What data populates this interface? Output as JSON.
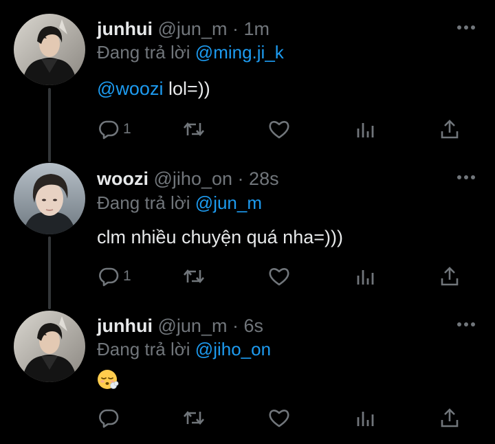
{
  "colors": {
    "background": "#000000",
    "primary_text": "#e7e9ea",
    "secondary_text": "#71767b",
    "link": "#1d9bf0",
    "thread_line": "#333639"
  },
  "reply_prefix": "Đang trả lời",
  "tweets": [
    {
      "name": "junhui",
      "handle": "@jun_m",
      "dot": "·",
      "time": "1m",
      "replying_to": "@ming.ji_k",
      "mention": "@woozi",
      "text": " lol=))",
      "reply_count": "1",
      "avatar_icon": "avatar-photo"
    },
    {
      "name": "woozi",
      "handle": "@jiho_on",
      "dot": "·",
      "time": "28s",
      "replying_to": "@jun_m",
      "text": "clm nhiều chuyện quá nha=)))",
      "reply_count": "1",
      "avatar_icon": "avatar-photo"
    },
    {
      "name": "junhui",
      "handle": "@jun_m",
      "dot": "·",
      "time": "6s",
      "replying_to": "@jiho_on",
      "emoji": "face-exhaling-emoji",
      "reply_count": "",
      "avatar_icon": "avatar-photo"
    }
  ],
  "icons": {
    "more": "more-horizontal-icon",
    "reply": "reply-bubble-icon",
    "retweet": "retweet-icon",
    "like": "heart-icon",
    "views": "views-chart-icon",
    "share": "share-icon"
  }
}
